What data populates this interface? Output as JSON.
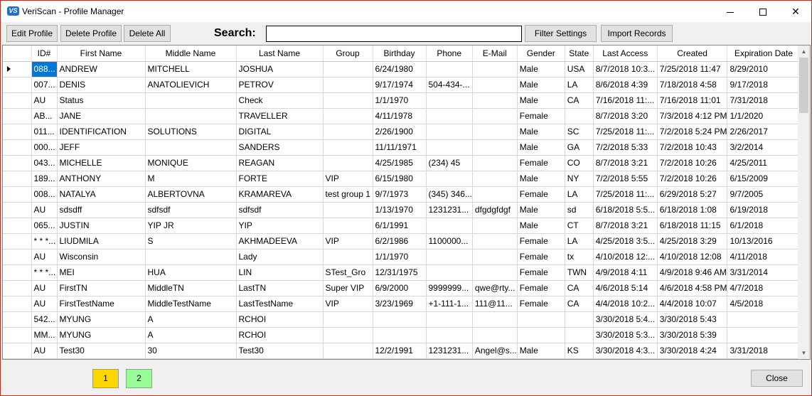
{
  "window": {
    "title": "VeriScan - Profile Manager",
    "logo_text": "VS",
    "minimize_icon": "minimize-icon",
    "maximize_icon": "maximize-icon",
    "close_glyph": "✕"
  },
  "toolbar": {
    "edit_profile": "Edit Profile",
    "delete_profile": "Delete Profile",
    "delete_all": "Delete All",
    "search_label": "Search:",
    "search_value": "",
    "filter_settings": "Filter Settings",
    "import_records": "Import Records"
  },
  "grid": {
    "columns": [
      "ID#",
      "First Name",
      "Middle Name",
      "Last Name",
      "Group",
      "Birthday",
      "Phone",
      "E-Mail",
      "Gender",
      "State",
      "Last Access",
      "Created",
      "Expiration Date"
    ],
    "rows": [
      [
        "088...",
        "ANDREW",
        "MITCHELL",
        "JOSHUA",
        "",
        "6/24/1980",
        "",
        "",
        "Male",
        "USA",
        "8/7/2018 10:3...",
        "7/25/2018 11:47",
        "8/29/2010"
      ],
      [
        "007...",
        "DENIS",
        "ANATOLIEVICH",
        "PETROV",
        "",
        "9/17/1974",
        "504-434-...",
        "",
        "Male",
        "LA",
        "8/6/2018 4:39",
        "7/18/2018 4:58",
        "9/17/2018"
      ],
      [
        "AU",
        "Status",
        "",
        "Check",
        "",
        "1/1/1970",
        "",
        "",
        "Male",
        "CA",
        "7/16/2018 11:...",
        "7/16/2018 11:01",
        "7/31/2018"
      ],
      [
        "AB...",
        "JANE",
        "",
        "TRAVELLER",
        "",
        "4/11/1978",
        "",
        "",
        "Female",
        "",
        "8/7/2018 3:20",
        "7/3/2018 4:12 PM",
        "1/1/2020"
      ],
      [
        "011...",
        "IDENTIFICATION",
        "SOLUTIONS",
        "DIGITAL",
        "",
        "2/26/1900",
        "",
        "",
        "Male",
        "SC",
        "7/25/2018 11:...",
        "7/2/2018 5:24 PM",
        "2/26/2017"
      ],
      [
        "000...",
        "JEFF",
        "",
        "SANDERS",
        "",
        "11/11/1971",
        "",
        "",
        "Male",
        "GA",
        "7/2/2018 5:33",
        "7/2/2018 10:43",
        "3/2/2014"
      ],
      [
        "043...",
        "MICHELLE",
        "MONIQUE",
        "REAGAN",
        "",
        "4/25/1985",
        "(234) 45",
        "",
        "Female",
        "CO",
        "8/7/2018 3:21",
        "7/2/2018 10:26",
        "4/25/2011"
      ],
      [
        "189...",
        "ANTHONY",
        "M",
        "FORTE",
        "VIP",
        "6/15/1980",
        "",
        "",
        "Male",
        "NY",
        "7/2/2018 5:55",
        "7/2/2018 10:26",
        "6/15/2009"
      ],
      [
        "008...",
        "NATALYA",
        "ALBERTOVNA",
        "KRAMAREVA",
        "test group 1",
        "9/7/1973",
        "(345) 346...",
        "",
        "Female",
        "LA",
        "7/25/2018 11:...",
        "6/29/2018 5:27",
        "9/7/2005"
      ],
      [
        "AU",
        "sdsdff",
        "sdfsdf",
        "sdfsdf",
        "",
        "1/13/1970",
        "1231231...",
        "dfgdgfdgf",
        "Male",
        "sd",
        "6/18/2018 5:5...",
        "6/18/2018 1:08",
        "6/19/2018"
      ],
      [
        "065...",
        "JUSTIN",
        "YIP JR",
        "YIP",
        "",
        "6/1/1991",
        "",
        "",
        "Male",
        "CT",
        "8/7/2018 3:21",
        "6/18/2018 11:15",
        "6/1/2018"
      ],
      [
        "* * *...",
        "LIUDMILA",
        "S",
        "AKHMADEEVA",
        "VIP",
        "6/2/1986",
        "1100000...",
        "",
        "Female",
        "LA",
        "4/25/2018 3:5...",
        "4/25/2018 3:29",
        "10/13/2016"
      ],
      [
        "AU",
        "Wisconsin",
        "",
        "Lady",
        "",
        "1/1/1970",
        "",
        "",
        "Female",
        "tx",
        "4/10/2018 12:...",
        "4/10/2018 12:08",
        "4/11/2018"
      ],
      [
        "* * *...",
        "MEI",
        "HUA",
        "LIN",
        "STest_Gro",
        "12/31/1975",
        "",
        "",
        "Female",
        "TWN",
        "4/9/2018 4:11",
        "4/9/2018 9:46 AM",
        "3/31/2014"
      ],
      [
        "AU",
        "FirstTN",
        "MiddleTN",
        "LastTN",
        "Super VIP",
        "6/9/2000",
        "9999999...",
        "qwe@rty...",
        "Female",
        "CA",
        "4/6/2018 5:14",
        "4/6/2018 4:58 PM",
        "4/7/2018"
      ],
      [
        "AU",
        "FirstTestName",
        "MiddleTestName",
        "LastTestName",
        "VIP",
        "3/23/1969",
        "+1-111-1...",
        "111@11...",
        "Female",
        "CA",
        "4/4/2018 10:2...",
        "4/4/2018 10:07",
        "4/5/2018"
      ],
      [
        "542...",
        "MYUNG",
        "A",
        "RCHOI",
        "",
        "",
        "",
        "",
        "",
        "",
        "3/30/2018 5:4...",
        "3/30/2018 5:43",
        ""
      ],
      [
        "MM...",
        "MYUNG",
        "A",
        "RCHOI",
        "",
        "",
        "",
        "",
        "",
        "",
        "3/30/2018 5:3...",
        "3/30/2018 5:39",
        ""
      ],
      [
        "AU",
        "Test30",
        "30",
        "Test30",
        "",
        "12/2/1991",
        "1231231...",
        "Angel@s...",
        "Male",
        "KS",
        "3/30/2018 4:3...",
        "3/30/2018 4:24",
        "3/31/2018"
      ]
    ]
  },
  "pagination": {
    "pages": [
      "1",
      "2"
    ],
    "current_page": "1",
    "page1_color": "#ffd700",
    "page2_color": "#98fb98"
  },
  "footer": {
    "close_label": "Close"
  },
  "colors": {
    "selection": "#0078d7",
    "window_border": "#c42b1c"
  }
}
